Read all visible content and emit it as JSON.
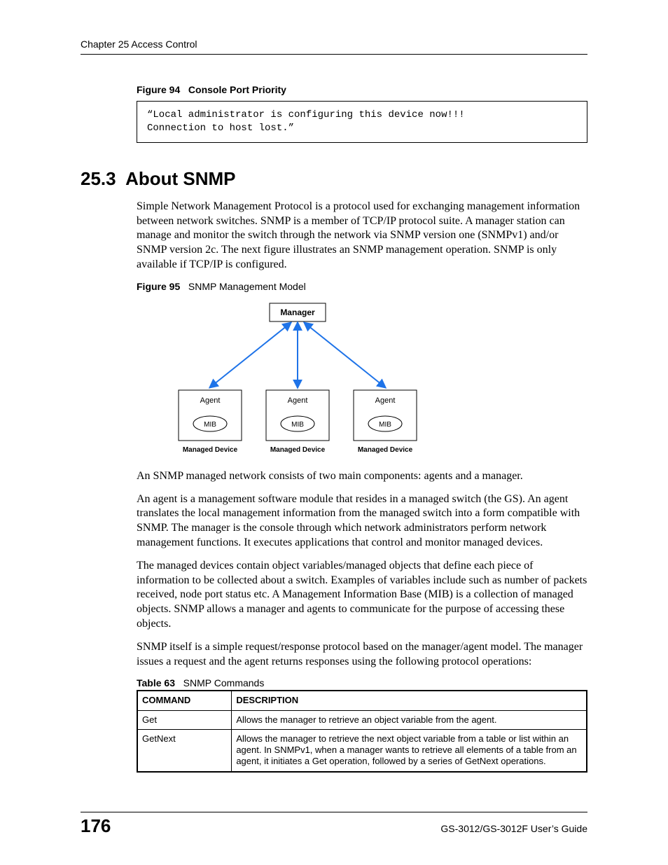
{
  "header": {
    "chapter": "Chapter 25 Access Control"
  },
  "figure94": {
    "label": "Figure 94",
    "title": "Console Port Priority",
    "code": "“Local administrator is configuring this device now!!!\nConnection to host lost.”"
  },
  "section": {
    "number": "25.3",
    "title": "About SNMP"
  },
  "paragraphs": {
    "p1": "Simple Network Management Protocol is a protocol used for exchanging management information between network switches. SNMP is a member of TCP/IP protocol suite. A manager station can manage and monitor the switch through the network via SNMP version one (SNMPv1) and/or SNMP version 2c. The next figure illustrates an SNMP management operation. SNMP is only available if TCP/IP is configured.",
    "p2": "An SNMP managed network consists of two main components: agents and a manager.",
    "p3": "An agent is a management software module that resides in a managed switch (the GS). An agent translates the local management information from the managed switch into a form compatible with SNMP. The manager is the console through which network administrators perform network management functions. It executes applications that control and monitor managed devices.",
    "p4": "The managed devices contain object variables/managed objects that define each piece of information to be collected about a switch. Examples of variables include such as number of packets received, node port status etc. A Management Information Base (MIB) is a collection of managed objects. SNMP allows a manager and agents to communicate for the purpose of accessing these objects.",
    "p5": "SNMP itself is a simple request/response protocol based on the manager/agent model. The manager issues a request and the agent returns responses using the following protocol operations:"
  },
  "figure95": {
    "label": "Figure 95",
    "title": "SNMP Management Model",
    "labels": {
      "manager": "Manager",
      "agent": "Agent",
      "mib": "MIB",
      "managed": "Managed Device"
    }
  },
  "table63": {
    "label": "Table 63",
    "title": "SNMP Commands",
    "headers": {
      "c1": "COMMAND",
      "c2": "DESCRIPTION"
    },
    "rows": [
      {
        "cmd": "Get",
        "desc": "Allows the manager to retrieve an object variable from the agent."
      },
      {
        "cmd": "GetNext",
        "desc": "Allows the manager to retrieve the next object variable from a table or list within an agent. In SNMPv1, when a manager wants to retrieve all elements of a table from an agent, it initiates a Get operation, followed by a series of GetNext operations."
      }
    ]
  },
  "footer": {
    "page": "176",
    "guide": "GS-3012/GS-3012F User’s Guide"
  },
  "chart_data": {
    "type": "diagram",
    "description": "SNMP Management Model: one Manager node at the top connected by bidirectional arrows to three Managed Device nodes below. Each Managed Device contains an Agent box and a MIB oval.",
    "nodes": {
      "manager": {
        "label": "Manager"
      },
      "devices": [
        {
          "agent": "Agent",
          "mib": "MIB",
          "caption": "Managed Device"
        },
        {
          "agent": "Agent",
          "mib": "MIB",
          "caption": "Managed Device"
        },
        {
          "agent": "Agent",
          "mib": "MIB",
          "caption": "Managed Device"
        }
      ]
    },
    "edges": [
      {
        "from": "manager",
        "to": "device1",
        "bidirectional": true
      },
      {
        "from": "manager",
        "to": "device2",
        "bidirectional": true
      },
      {
        "from": "manager",
        "to": "device3",
        "bidirectional": true
      }
    ]
  }
}
